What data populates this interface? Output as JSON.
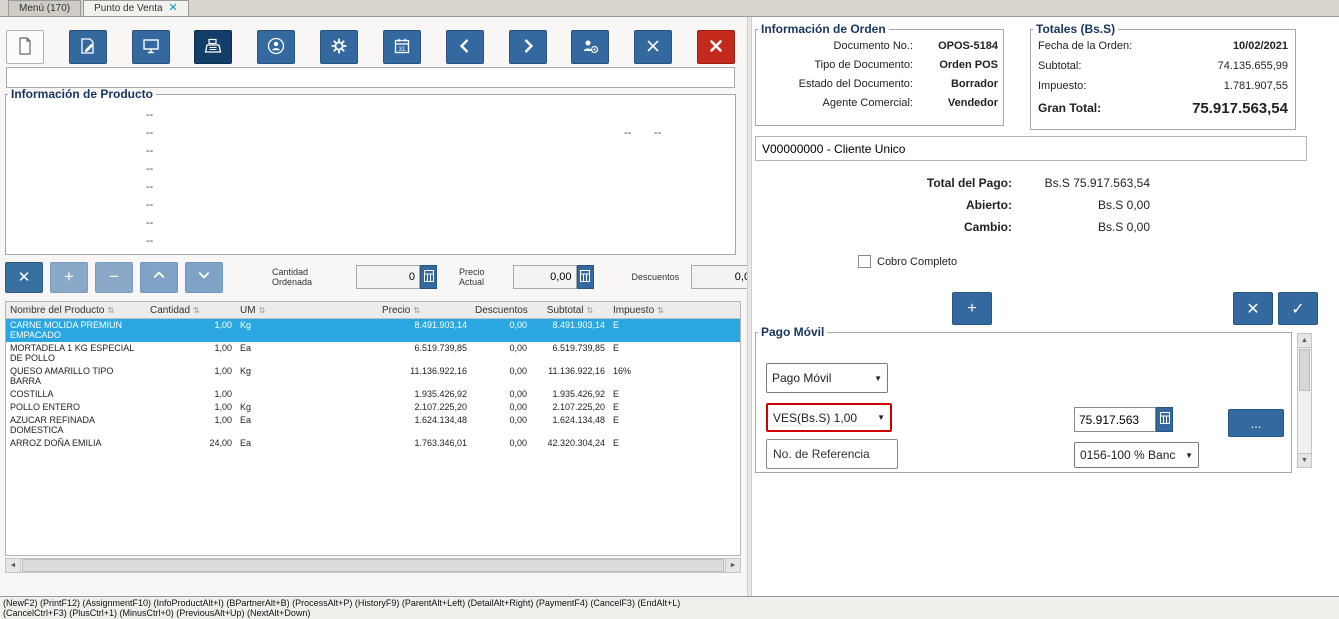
{
  "window": {
    "tabs": [
      {
        "label": "Menú (170)"
      },
      {
        "label": "Punto de Venta"
      }
    ]
  },
  "icons": {
    "tab_close": "✕",
    "sort": "⇅",
    "plus": "+",
    "minus": "−",
    "delete_x": "✕",
    "check": "✓",
    "caret_down": "▼",
    "scroll_up": "▲",
    "scroll_down": "▼",
    "scroll_left": "◄",
    "scroll_right": "►"
  },
  "colors": {
    "accent_blue": "#34699f",
    "dark_blue": "#123e69",
    "alert_red": "#c32a1c",
    "selected_row_blue": "#2aa7e1",
    "highlight_border_red": "#cc0000"
  },
  "product_info": {
    "title": "Información de Producto",
    "dash": "--"
  },
  "quantity_controls": {
    "cantidad_label": "Cantidad\nOrdenada",
    "cantidad_value": "0",
    "precio_label": "Precio\nActual",
    "precio_value": "0,00",
    "descuentos_label": "Descuentos",
    "descuentos_value": "0,0"
  },
  "order_table": {
    "columns": [
      "Nombre del Producto",
      "Cantidad",
      "UM",
      "Precio",
      "Descuentos",
      "Subtotal",
      "Impuesto"
    ],
    "rows": [
      {
        "name": "CARNE MOLIDA PREMIUN EMPACADO",
        "qty": "1,00",
        "um": "Kg",
        "price": "8.491.903,14",
        "discount": "0,00",
        "subtotal": "8.491.903,14",
        "tax": "E"
      },
      {
        "name": "MORTADELA 1 KG ESPECIAL DE POLLO",
        "qty": "1,00",
        "um": "Ea",
        "price": "6.519.739,85",
        "discount": "0,00",
        "subtotal": "6.519.739,85",
        "tax": "E"
      },
      {
        "name": "QUESO AMARILLO TIPO BARRA",
        "qty": "1,00",
        "um": "Kg",
        "price": "11.136.922,16",
        "discount": "0,00",
        "subtotal": "11.136.922,16",
        "tax": "16%"
      },
      {
        "name": "COSTILLA",
        "qty": "1,00",
        "um": "",
        "price": "1.935.426,92",
        "discount": "0,00",
        "subtotal": "1.935.426,92",
        "tax": "E"
      },
      {
        "name": "POLLO ENTERO",
        "qty": "1,00",
        "um": "Kg",
        "price": "2.107.225,20",
        "discount": "0,00",
        "subtotal": "2.107.225,20",
        "tax": "E"
      },
      {
        "name": "AZUCAR REFINADA DOMESTICA",
        "qty": "1,00",
        "um": "Ea",
        "price": "1.624.134,48",
        "discount": "0,00",
        "subtotal": "1.624.134,48",
        "tax": "E"
      },
      {
        "name": "ARROZ DOÑA EMILIA",
        "qty": "24,00",
        "um": "Ea",
        "price": "1.763.346,01",
        "discount": "0,00",
        "subtotal": "42.320.304,24",
        "tax": "E"
      }
    ]
  },
  "order_info": {
    "title": "Información de Orden",
    "fields": [
      {
        "label": "Documento No.:",
        "value": "OPOS-5184"
      },
      {
        "label": "Tipo de Documento:",
        "value": "Orden POS"
      },
      {
        "label": "Estado del Documento:",
        "value": "Borrador"
      },
      {
        "label": "Agente Comercial:",
        "value": "Vendedor"
      }
    ]
  },
  "totals": {
    "title": "Totales (Bs.S)",
    "fields": [
      {
        "label": "Fecha de la Orden:",
        "value": "10/02/2021"
      },
      {
        "label": "Subtotal:",
        "value": "74.135.655,99"
      },
      {
        "label": "Impuesto:",
        "value": "1.781.907,55"
      },
      {
        "label": "Gran Total:",
        "value": "75.917.563,54"
      }
    ]
  },
  "customer": {
    "value": "V00000000 - Cliente Unico"
  },
  "payment_summary": {
    "rows": [
      {
        "label": "Total del Pago:",
        "value": "Bs.S 75.917.563,54"
      },
      {
        "label": "Abierto:",
        "value": "Bs.S 0,00"
      },
      {
        "label": "Cambio:",
        "value": "Bs.S 0,00"
      }
    ],
    "cobro_completo": "Cobro Completo"
  },
  "payment_panel": {
    "title": "Pago Móvil",
    "method": "Pago Móvil",
    "currency": "VES(Bs.S) 1,00",
    "reference_placeholder": "No. de Referencia",
    "amount": "75.917.563",
    "bank": "0156-100 % Banc",
    "more_label": "..."
  },
  "statusbar": {
    "line1": "(NewF2) (PrintF12) (AssignmentF10) (InfoProductAlt+I) (BPartnerAlt+B) (ProcessAlt+P) (HistoryF9) (ParentAlt+Left) (DetailAlt+Right) (PaymentF4) (CancelF3) (EndAlt+L)",
    "line2": "(CancelCtrl+F3) (PlusCtrl+1) (MinusCtrl+0) (PreviousAlt+Up) (NextAlt+Down)"
  }
}
